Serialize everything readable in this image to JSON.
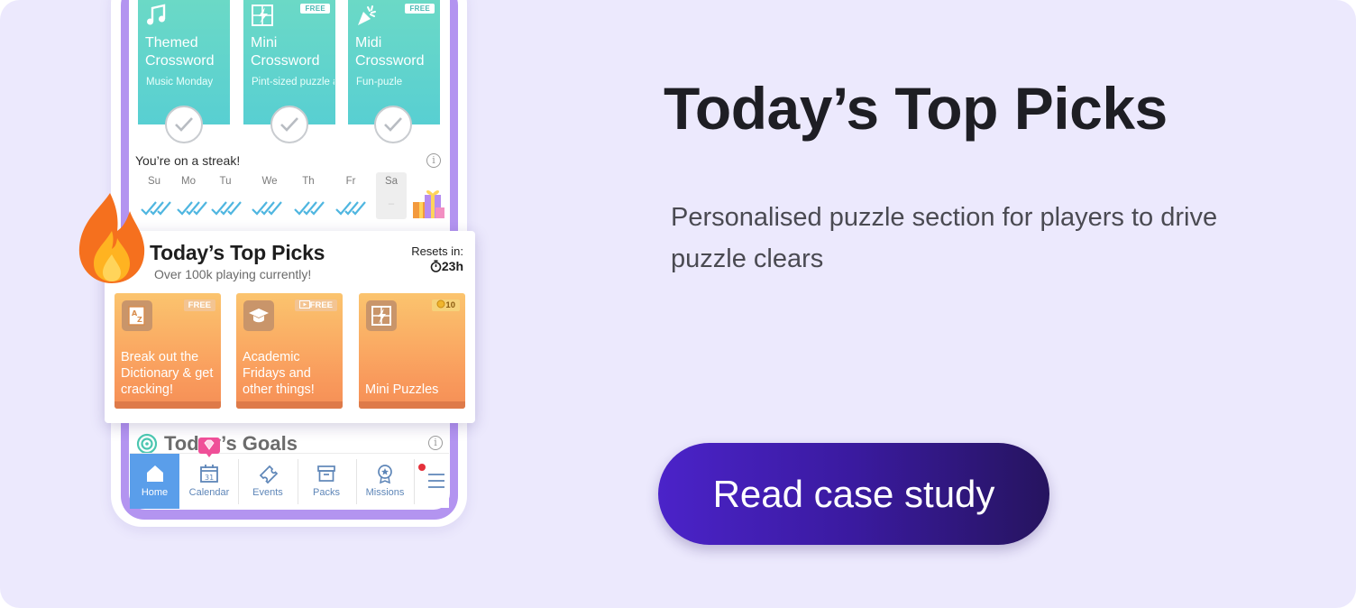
{
  "colors": {
    "background": "#ece9fd",
    "crossword_tile": "#5fd3cd",
    "pick_tile": "#f9a85f",
    "cta": "#3a1a9f",
    "nav_active": "#5a9eea"
  },
  "crosswords": [
    {
      "title": "Themed Crossword",
      "subtitle": "Music Monday",
      "badge": "",
      "icon": "music-note-icon"
    },
    {
      "title": "Mini Crossword",
      "subtitle": "Pint-sized puzzle and bla",
      "badge": "FREE",
      "icon": "mini-crossword-icon"
    },
    {
      "title": "Midi Crossword",
      "subtitle": "Fun-puzle",
      "badge": "FREE",
      "icon": "party-popper-icon"
    }
  ],
  "streak": {
    "label": "You’re on a streak!",
    "days": [
      "Su",
      "Mo",
      "Tu",
      "We",
      "Th",
      "Fr",
      "Sa"
    ],
    "saturday_mark": "–"
  },
  "top_picks": {
    "title": "Today’s Top Picks",
    "subtitle": "Over 100k playing currently!",
    "resets_label": "Resets in:",
    "resets_time": "23h",
    "tiles": [
      {
        "label": "Break out the Dictionary & get cracking!",
        "badge": "FREE",
        "icon": "dictionary-icon"
      },
      {
        "label": "Academic Fridays and other things!",
        "badge": "FREE",
        "icon": "graduation-cap-icon"
      },
      {
        "label": "Mini Puzzles",
        "badge": "10",
        "icon": "mini-puzzle-icon"
      }
    ]
  },
  "goals": {
    "title": "Today’s Goals"
  },
  "nav": {
    "items": [
      {
        "label": "Home",
        "icon": "home-icon"
      },
      {
        "label": "Calendar",
        "icon": "calendar-icon"
      },
      {
        "label": "Events",
        "icon": "ticket-icon"
      },
      {
        "label": "Packs",
        "icon": "packs-icon"
      },
      {
        "label": "Missions",
        "icon": "missions-icon"
      }
    ],
    "calendar_date": "31"
  },
  "hero": {
    "headline": "Today’s Top Picks",
    "description": "Personalised puzzle section for players to drive puzzle clears",
    "cta_label": "Read case study"
  }
}
